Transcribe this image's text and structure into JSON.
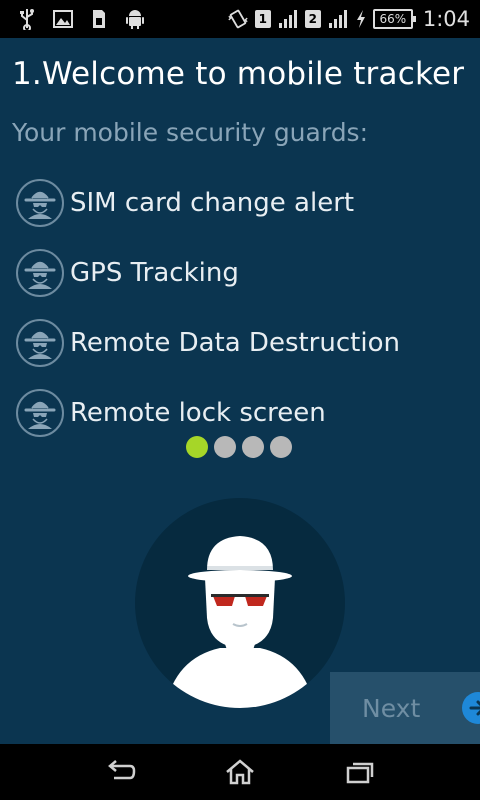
{
  "status_bar": {
    "sim1": "1",
    "sim2": "2",
    "battery": "66%",
    "time": "1:04",
    "icons": [
      "usb-icon",
      "image-icon",
      "sim-card-icon",
      "android-icon",
      "vibrate-icon",
      "signal-icon",
      "charging-icon"
    ]
  },
  "screen": {
    "title": "1.Welcome to mobile tracker",
    "subtitle": "Your mobile security guards:"
  },
  "features": [
    {
      "label": "SIM card change alert",
      "icon": "spy-icon"
    },
    {
      "label": "GPS Tracking",
      "icon": "spy-icon"
    },
    {
      "label": "Remote Data Destruction",
      "icon": "spy-icon"
    },
    {
      "label": "Remote lock screen",
      "icon": "spy-icon"
    }
  ],
  "pager": {
    "total": 4,
    "active_index": 0
  },
  "next_button": {
    "label": "Next"
  },
  "colors": {
    "background": "#0b3550",
    "accent_dot": "#a6d628",
    "next_arrow": "#1e88d8"
  }
}
